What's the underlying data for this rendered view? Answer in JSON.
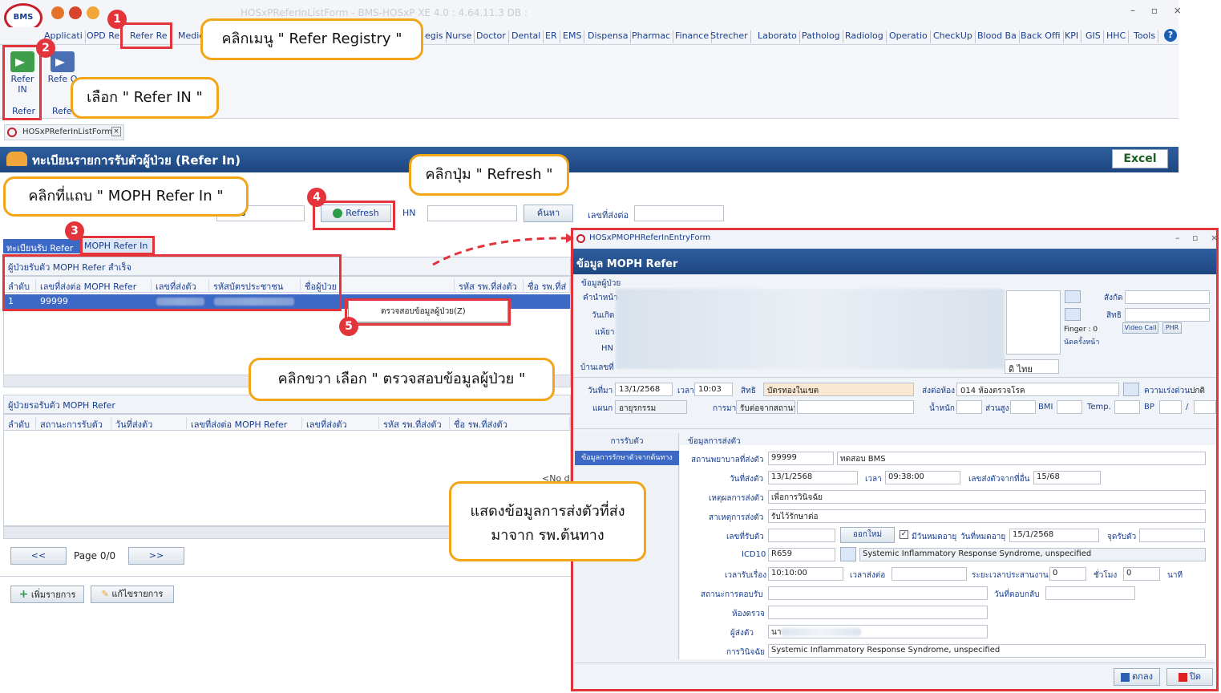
{
  "app": {
    "title": "HOSxPReferInListForm - BMS-HOSxP XE 4.0 : 4.64.11.3 DB :",
    "logo_text": "BMS",
    "window_controls": "– ▫ ×"
  },
  "menubar": [
    "Applicati",
    "OPD Re",
    "Refer Re",
    "Medic",
    "egis",
    "Nurse",
    "Doctor",
    "Dental",
    "ER",
    "EMS",
    "Dispensa",
    "Pharmac",
    "Finance",
    "Strecher",
    "Laborato",
    "Patholog",
    "Radiolog",
    "Operatio",
    "CheckUp",
    "Blood Ba",
    "Back Offi",
    "KPI",
    "GIS",
    "HHC",
    "Tools"
  ],
  "ribbon": {
    "refer_in_label": "Refer IN",
    "refer_out_label": "Refe O",
    "group_label": "Refer",
    "group_label_2": "Refe"
  },
  "doc_tab": "HOSxPReferInListForm",
  "main": {
    "title": "ทะเบียนรายการรับตัวผู้ป่วย (Refer In)",
    "excel_button": "Excel",
    "date_value": "/2568",
    "refresh_button": "Refresh",
    "hn_label": "HN",
    "search_button": "ค้นหา",
    "refer_no_label": "เลขที่ส่งต่อ",
    "tabs": [
      "ทะเบียนรับ Refer",
      "MOPH Refer In"
    ],
    "success_group": "ผู้ป่วยรับตัว MOPH Refer สำเร็จ",
    "success_columns": [
      "ลำดับ",
      "เลขที่ส่งต่อ MOPH Refer",
      "เลขที่ส่งตัว",
      "รหัสบัตรประชาชน",
      "ชื่อผู้ป่วย",
      "รหัส รพ.ที่ส่งตัว",
      "ชื่อ รพ.ที่ส่"
    ],
    "success_rows": [
      {
        "seq": "1",
        "moph_no": "99999"
      }
    ],
    "context_menu_item": "ตรวจสอบข้อมูลผู้ป่วย(Z)",
    "pending_group": "ผู้ป่วยรอรับตัว MOPH Refer",
    "pending_columns": [
      "ลำดับ",
      "สถานะการรับตัว",
      "วันที่ส่งตัว",
      "เลขที่ส่งต่อ MOPH Refer",
      "เลขที่ส่งตัว",
      "รหัส รพ.ที่ส่งตัว",
      "ชื่อ รพ.ที่ส่งตัว"
    ],
    "no_data": "<No d",
    "page_prev": "<<",
    "page_label": "Page 0/0",
    "page_next": ">>",
    "add_button": "เพิ่มรายการ",
    "edit_button": "แก้ไขรายการ"
  },
  "form": {
    "tab_title": "HOSxPMOPHReferInEntryForm",
    "header": "ข้อมูล MOPH Refer",
    "patient_group": "ข้อมูลผู้ป่วย",
    "left_labels": [
      "คำนำหน้า",
      "วันเกิด",
      "แพ้ยา",
      "HN",
      "บ้านเลขที่"
    ],
    "right_labels": [
      "สังกัด",
      "สิทธิ"
    ],
    "finger": "Finger : 0",
    "appointment": "นัดครั้งหน้า",
    "video_call": "Video Call",
    "phr": "PHR",
    "nationality": "ดิ ไทย",
    "visit": {
      "date_label": "วันที่มา",
      "date": "13/1/2568",
      "time_label": "เวลา",
      "time": "10:03",
      "right_label": "สิทธิ",
      "right": "บัตรทองในเขต",
      "send_room_label": "ส่งต่อห้อง",
      "send_room": "014 ห้องตรวจโรค",
      "urgency_label": "ความเร่งด่วน",
      "urgency": "ปกติ",
      "dept_label": "แผนก",
      "dept": "อายุรกรรม",
      "come_label": "การมา",
      "come": "รับต่อจากสถานฯ",
      "weight": "น้ำหนัก",
      "height": "ส่วนสูง",
      "bmi": "BMI",
      "temp": "Temp.",
      "bp": "BP",
      "bp_sep": "/"
    },
    "side_tabs": [
      "การรับตัว",
      "ข้อมูลการรักษาตัวจากต้นทาง"
    ],
    "section": "ข้อมูลการส่งตัว",
    "hosp_label": "สถานพยาบาลที่ส่งตัว",
    "hosp_code": "99999",
    "hosp_name": "ทดสอบ BMS",
    "send_date_label": "วันที่ส่งตัว",
    "send_date": "13/1/2568",
    "send_time_label": "เวลา",
    "send_time": "09:38:00",
    "other_no_label": "เลขส่งตัวจากที่อื่น",
    "other_no": "15/68",
    "reason_label": "เหตุผลการส่งตัว",
    "reason": "เพื่อการวินิจฉัย",
    "cause_label": "สาเหตุการส่งตัว",
    "cause": "รับไว้รักษาต่อ",
    "recv_no_label": "เลขที่รับตัว",
    "new_button": "ออกใหม่",
    "expire_check": "มีวันหมดอายุ",
    "expire_label": "วันที่หมดอายุ",
    "expire": "15/1/2568",
    "point_label": "จุดรับตัว",
    "icd_label": "ICD10",
    "icd": "R659",
    "icd_desc": "Systemic Inflammatory Response Syndrome, unspecified",
    "accept_time_label": "เวลารับเรื่อง",
    "accept_time": "10:10:00",
    "send_time2_label": "เวลาส่งต่อ",
    "coord_label": "ระยะเวลาประสานงาน",
    "hours": "0",
    "hours_label": "ชั่วโมง",
    "minutes": "0",
    "minutes_label": "นาที",
    "reply_status_label": "สถานะการตอบรับ",
    "reply_date_label": "วันที่ตอบกลับ",
    "room_label": "ห้องตรวจ",
    "sender_label": "ผู้ส่งตัว",
    "sender": "นา",
    "diag_label": "การวินิจฉัย",
    "diag": "Systemic Inflammatory Response Syndrome, unspecified",
    "save_button": "ตกลง",
    "close_button": "ปิด",
    "win_controls": "– ▫ ×"
  },
  "annotations": {
    "b1": "1",
    "b2": "2",
    "b3": "3",
    "b4": "4",
    "b5": "5",
    "c1": "คลิกเมนู \" Refer Registry \"",
    "c2": "เลือก \" Refer IN \"",
    "c3": "คลิกที่แถบ \" MOPH Refer In \"",
    "c4": "คลิกปุ่ม \" Refresh \"",
    "c5": "คลิกขวา เลือก \" ตรวจสอบข้อมูลผู้ป่วย \"",
    "c6": "แสดงข้อมูลการส่งตัวที่ส่งมาจาก รพ.ต้นทาง"
  },
  "colors": {
    "highlight": "#e2343a",
    "callout": "#f2a516",
    "header_blue": "#1d4680",
    "selected_row": "#3c68c6"
  }
}
